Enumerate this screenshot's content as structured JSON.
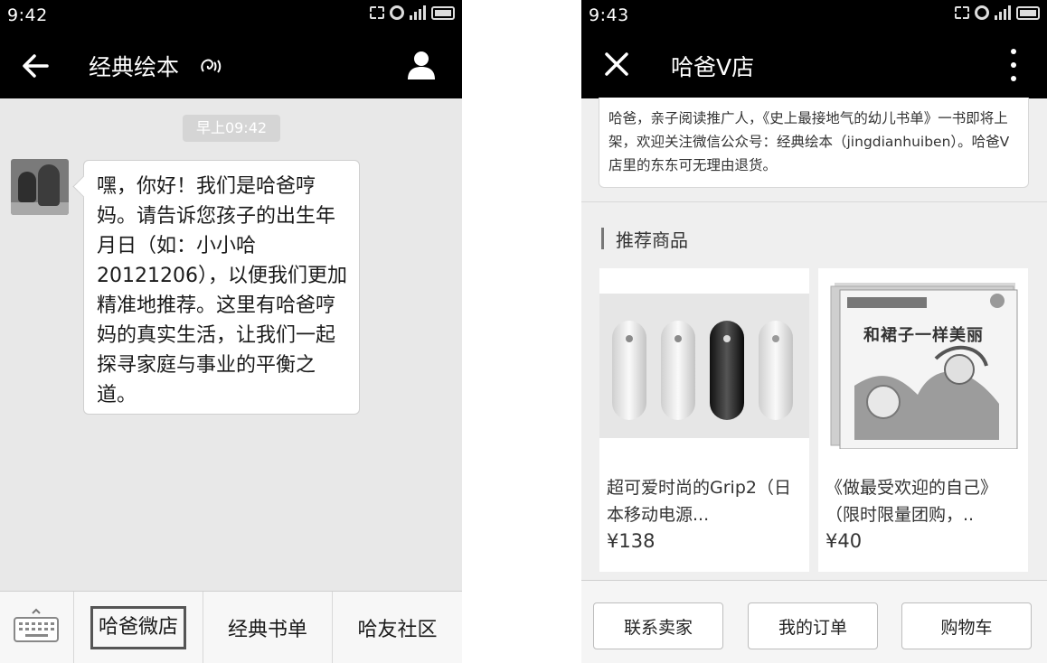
{
  "left_screen": {
    "status_time": "9:42",
    "title": "经典绘本",
    "timestamp": "早上09:42",
    "message_text": "嘿，你好！我们是哈爸哼妈。请告诉您孩子的出生年月日（如：小小哈20121206），以便我们更加精准地推荐。这里有哈爸哼妈的真实生活，让我们一起探寻家庭与事业的平衡之道。",
    "menu": [
      "哈爸微店",
      "经典书单",
      "哈友社区"
    ],
    "icons": [
      "back-arrow-icon",
      "voice-icon",
      "profile-icon",
      "keyboard-icon"
    ]
  },
  "right_screen": {
    "status_time": "9:43",
    "title": "哈爸V店",
    "notice": "哈爸，亲子阅读推广人，《史上最接地气的幼儿书单》一书即将上架，欢迎关注微信公众号：经典绘本（jingdianhuiben）。哈爸V店里的东东可无理由退货。",
    "section_title": "推荐商品",
    "products": [
      {
        "name": "超可爱时尚的Grip2（日本移动电源...",
        "price": "¥138",
        "image": "power-bank-product"
      },
      {
        "name": "《做最受欢迎的自己》（限时限量团购，..",
        "price": "¥40",
        "image": "picture-book-product",
        "cover_title": "和裙子一样美丽"
      }
    ],
    "buttons": [
      "联系卖家",
      "我的订单",
      "购物车"
    ],
    "icons": [
      "close-icon",
      "more-icon"
    ]
  },
  "colors": {
    "bar": "#000000",
    "chat_bg": "#e8e8e8",
    "bubble": "#ffffff",
    "shop_bg": "#efefef"
  }
}
